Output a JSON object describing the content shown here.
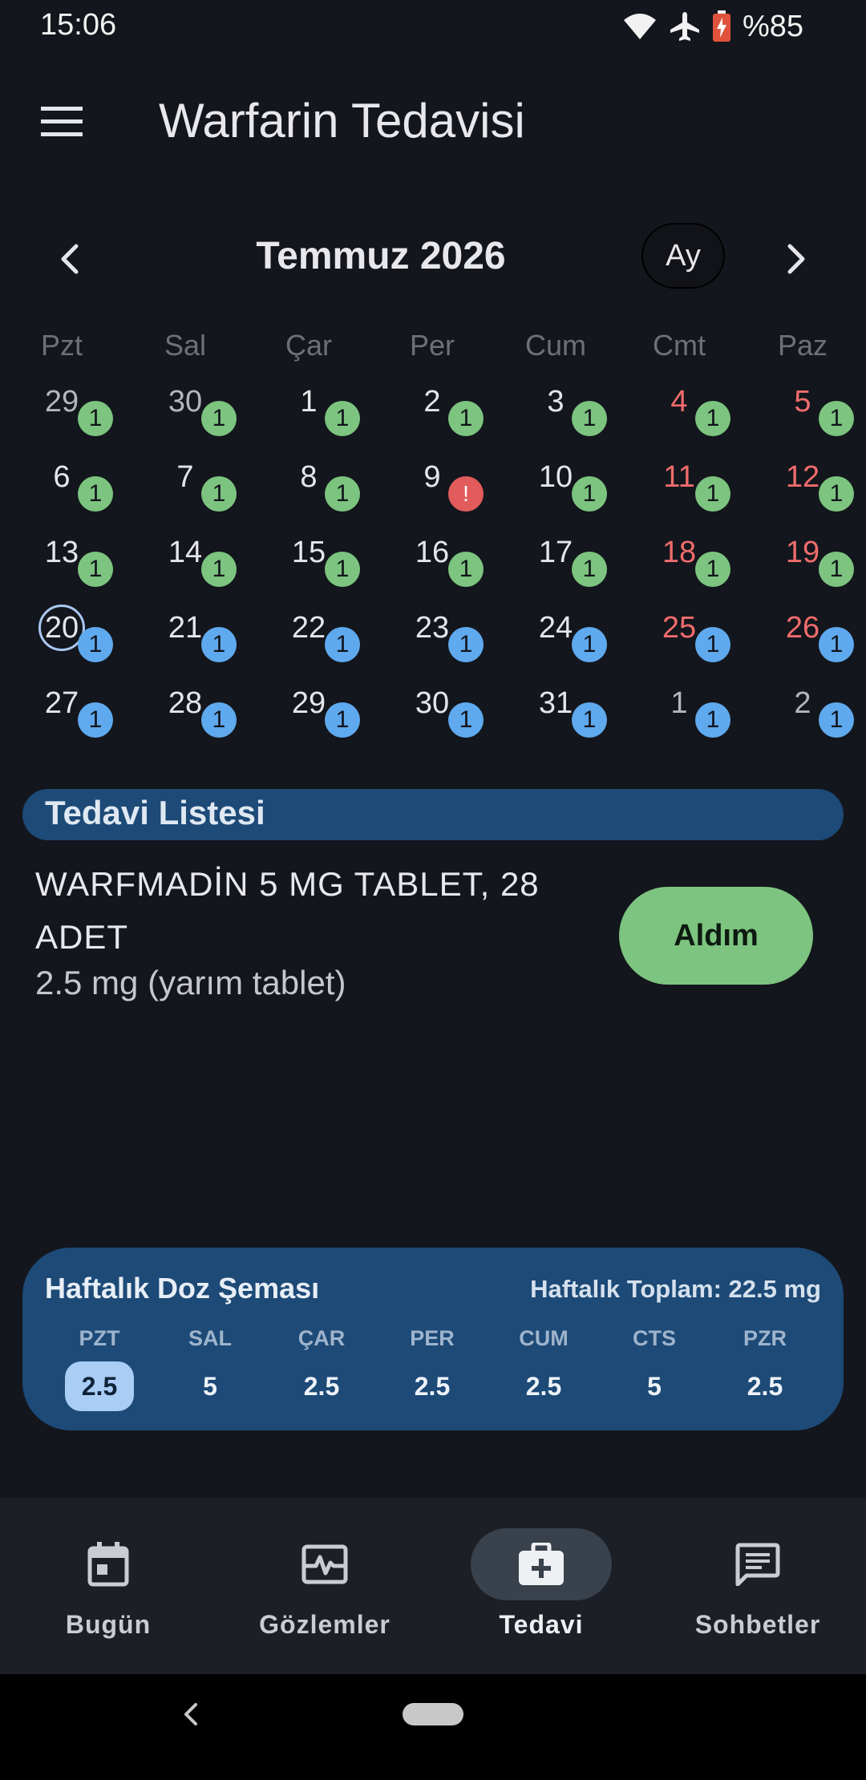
{
  "status_bar": {
    "time": "15:06",
    "battery": "%85"
  },
  "app_bar": {
    "title": "Warfarin Tedavisi",
    "menu_icon": "menu-icon"
  },
  "calendar": {
    "month_title": "Temmuz 2026",
    "view_toggle": "Ay",
    "weekdays": [
      "Pzt",
      "Sal",
      "Çar",
      "Per",
      "Cum",
      "Cmt",
      "Paz"
    ],
    "weeks": [
      [
        {
          "day": "29",
          "badge": "1",
          "status": "green",
          "muted": true
        },
        {
          "day": "30",
          "badge": "1",
          "status": "green",
          "muted": true
        },
        {
          "day": "1",
          "badge": "1",
          "status": "green"
        },
        {
          "day": "2",
          "badge": "1",
          "status": "green"
        },
        {
          "day": "3",
          "badge": "1",
          "status": "green"
        },
        {
          "day": "4",
          "badge": "1",
          "status": "green",
          "weekend": true
        },
        {
          "day": "5",
          "badge": "1",
          "status": "green",
          "weekend": true
        }
      ],
      [
        {
          "day": "6",
          "badge": "1",
          "status": "green"
        },
        {
          "day": "7",
          "badge": "1",
          "status": "green"
        },
        {
          "day": "8",
          "badge": "1",
          "status": "green"
        },
        {
          "day": "9",
          "badge": "!",
          "status": "red"
        },
        {
          "day": "10",
          "badge": "1",
          "status": "green"
        },
        {
          "day": "11",
          "badge": "1",
          "status": "green",
          "weekend": true
        },
        {
          "day": "12",
          "badge": "1",
          "status": "green",
          "weekend": true
        }
      ],
      [
        {
          "day": "13",
          "badge": "1",
          "status": "green"
        },
        {
          "day": "14",
          "badge": "1",
          "status": "green"
        },
        {
          "day": "15",
          "badge": "1",
          "status": "green"
        },
        {
          "day": "16",
          "badge": "1",
          "status": "green"
        },
        {
          "day": "17",
          "badge": "1",
          "status": "green"
        },
        {
          "day": "18",
          "badge": "1",
          "status": "green",
          "weekend": true
        },
        {
          "day": "19",
          "badge": "1",
          "status": "green",
          "weekend": true
        }
      ],
      [
        {
          "day": "20",
          "badge": "1",
          "status": "blue",
          "today": true
        },
        {
          "day": "21",
          "badge": "1",
          "status": "blue"
        },
        {
          "day": "22",
          "badge": "1",
          "status": "blue"
        },
        {
          "day": "23",
          "badge": "1",
          "status": "blue"
        },
        {
          "day": "24",
          "badge": "1",
          "status": "blue"
        },
        {
          "day": "25",
          "badge": "1",
          "status": "blue",
          "weekend": true
        },
        {
          "day": "26",
          "badge": "1",
          "status": "blue",
          "weekend": true
        }
      ],
      [
        {
          "day": "27",
          "badge": "1",
          "status": "blue"
        },
        {
          "day": "28",
          "badge": "1",
          "status": "blue"
        },
        {
          "day": "29",
          "badge": "1",
          "status": "blue"
        },
        {
          "day": "30",
          "badge": "1",
          "status": "blue"
        },
        {
          "day": "31",
          "badge": "1",
          "status": "blue"
        },
        {
          "day": "1",
          "badge": "1",
          "status": "blue",
          "muted": true
        },
        {
          "day": "2",
          "badge": "1",
          "status": "blue",
          "muted": true
        }
      ]
    ]
  },
  "treatment": {
    "section_title": "Tedavi Listesi",
    "medication_name": "WARFMADİN 5 MG TABLET, 28 ADET",
    "dose": "2.5 mg (yarım tablet)",
    "taken_button": "Aldım"
  },
  "weekly_dose": {
    "title": "Haftalık Doz Şeması",
    "total": "Haftalık Toplam: 22.5 mg",
    "days": [
      {
        "label": "PZT",
        "value": "2.5",
        "active": true
      },
      {
        "label": "SAL",
        "value": "5"
      },
      {
        "label": "ÇAR",
        "value": "2.5"
      },
      {
        "label": "PER",
        "value": "2.5"
      },
      {
        "label": "CUM",
        "value": "2.5"
      },
      {
        "label": "CTS",
        "value": "5"
      },
      {
        "label": "PZR",
        "value": "2.5"
      }
    ]
  },
  "bottom_nav": {
    "items": [
      {
        "label": "Bugün",
        "icon": "calendar-icon"
      },
      {
        "label": "Gözlemler",
        "icon": "monitor-pulse-icon"
      },
      {
        "label": "Tedavi",
        "icon": "medical-bag-icon",
        "active": true
      },
      {
        "label": "Sohbetler",
        "icon": "chat-icon"
      }
    ]
  },
  "colors": {
    "background": "#13161c",
    "accent_blue": "#1d4a77",
    "taken_green": "#7cc47f",
    "planned_blue": "#5fa9ee",
    "missed_red": "#e25c5c",
    "weekend_red": "#f06c6c"
  }
}
